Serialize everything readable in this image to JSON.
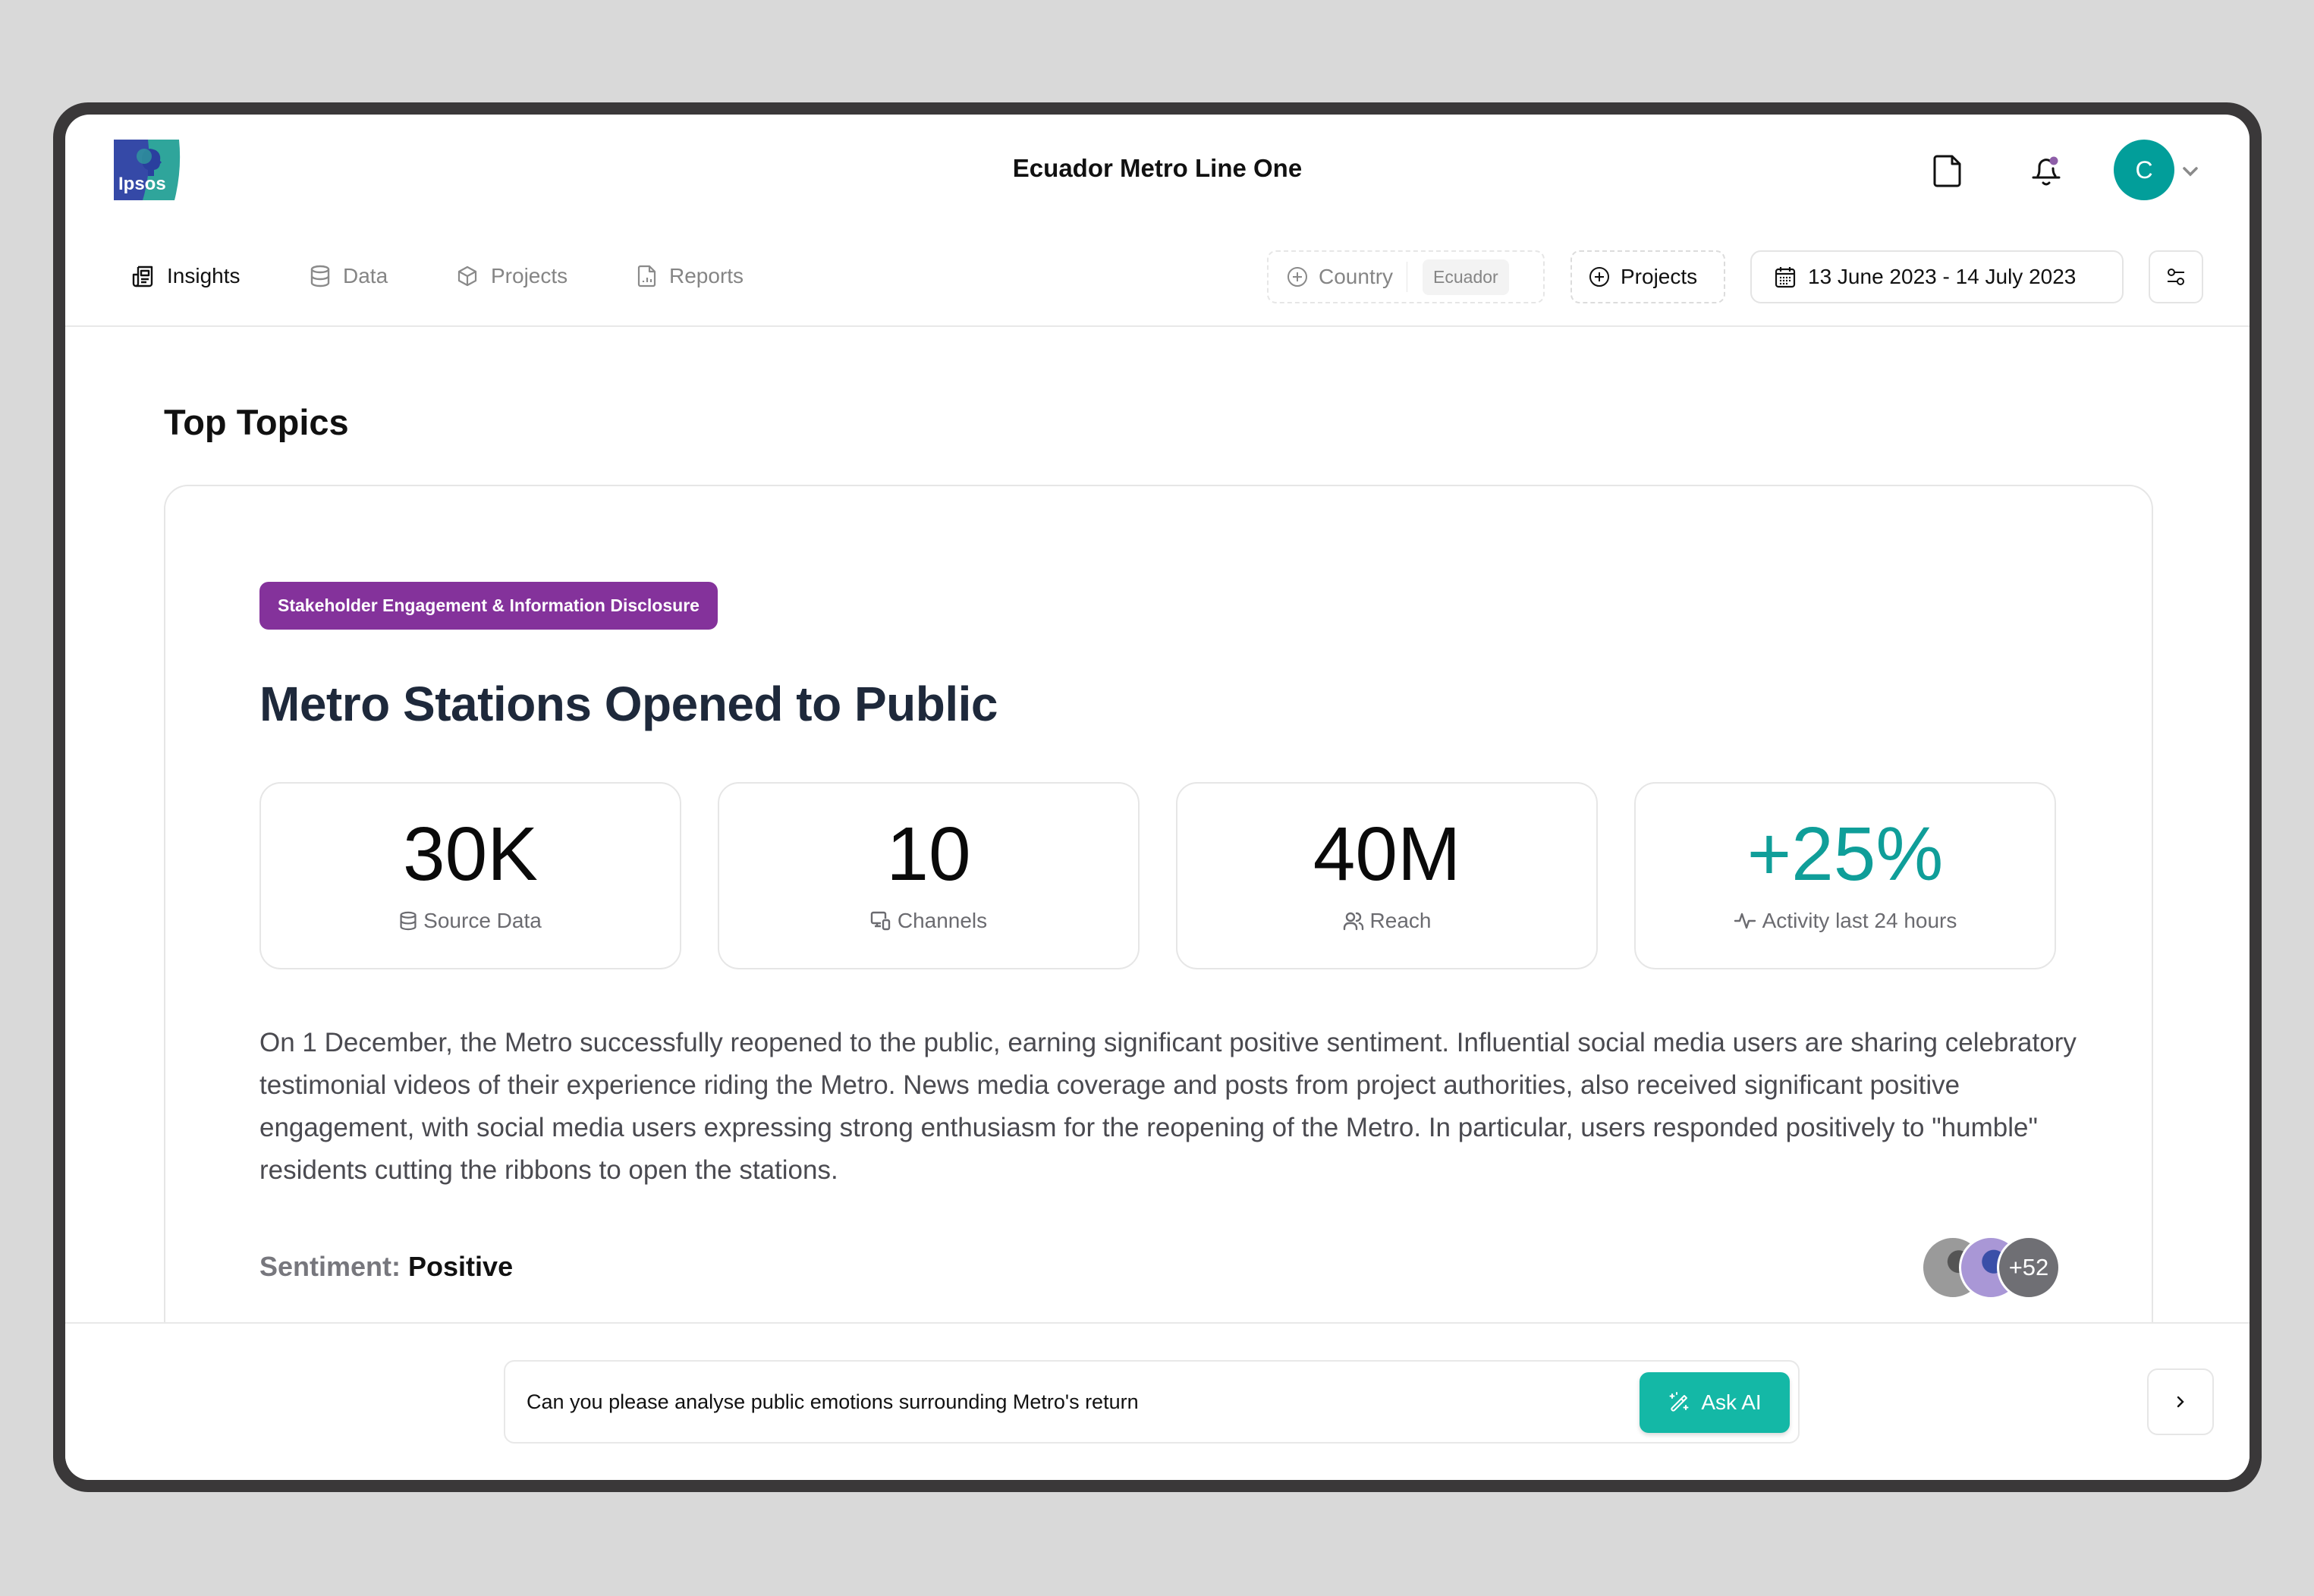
{
  "header": {
    "logo_text": "Ipsos",
    "title": "Ecuador Metro Line One",
    "icons": {
      "document": "document-icon",
      "notifications": "bell-icon",
      "user_menu": "chevron-down-icon"
    },
    "avatar_initial": "C",
    "notification_dot": true
  },
  "nav": {
    "items": [
      {
        "label": "Insights",
        "icon": "newspaper-icon",
        "active": true
      },
      {
        "label": "Data",
        "icon": "database-icon",
        "active": false
      },
      {
        "label": "Projects",
        "icon": "cube-icon",
        "active": false
      },
      {
        "label": "Reports",
        "icon": "file-chart-icon",
        "active": false
      }
    ]
  },
  "filters": {
    "country_label": "Country",
    "country_value": "Ecuador",
    "projects_label": "Projects",
    "date_range": "13 June 2023 - 14 July 2023"
  },
  "main": {
    "section_title": "Top Topics",
    "topic": {
      "tag": "Stakeholder Engagement & Information Disclosure",
      "headline": "Metro Stations Opened to Public",
      "stats": [
        {
          "value": "30K",
          "label": "Source Data",
          "icon": "database-icon"
        },
        {
          "value": "10",
          "label": "Channels",
          "icon": "devices-icon"
        },
        {
          "value": "40M",
          "label": "Reach",
          "icon": "users-icon"
        },
        {
          "value": "+25%",
          "label": "Activity last 24 hours",
          "icon": "activity-icon"
        }
      ],
      "summary": "On 1 December, the Metro successfully reopened to the public, earning significant positive sentiment. Influential social media users are sharing celebratory testimonial videos of their experience riding the Metro. News media coverage and posts from project authorities, also received significant positive engagement, with social media users expressing strong enthusiasm for the reopening of the Metro. In particular, users responded positively to \"humble\" residents cutting the ribbons to open the stations.",
      "sentiment_label": "Sentiment:",
      "sentiment_value": "Positive",
      "contributors_more": "+52"
    }
  },
  "ask": {
    "input_value": "Can you please analyse public emotions surrounding Metro's return",
    "button_label": "Ask AI"
  },
  "colors": {
    "accent_teal": "#0f9e99",
    "avatar": "#029e9a",
    "tag_purple": "#84329b",
    "ask_button": "#14b8a6",
    "notification_dot": "#8e5ea8"
  }
}
